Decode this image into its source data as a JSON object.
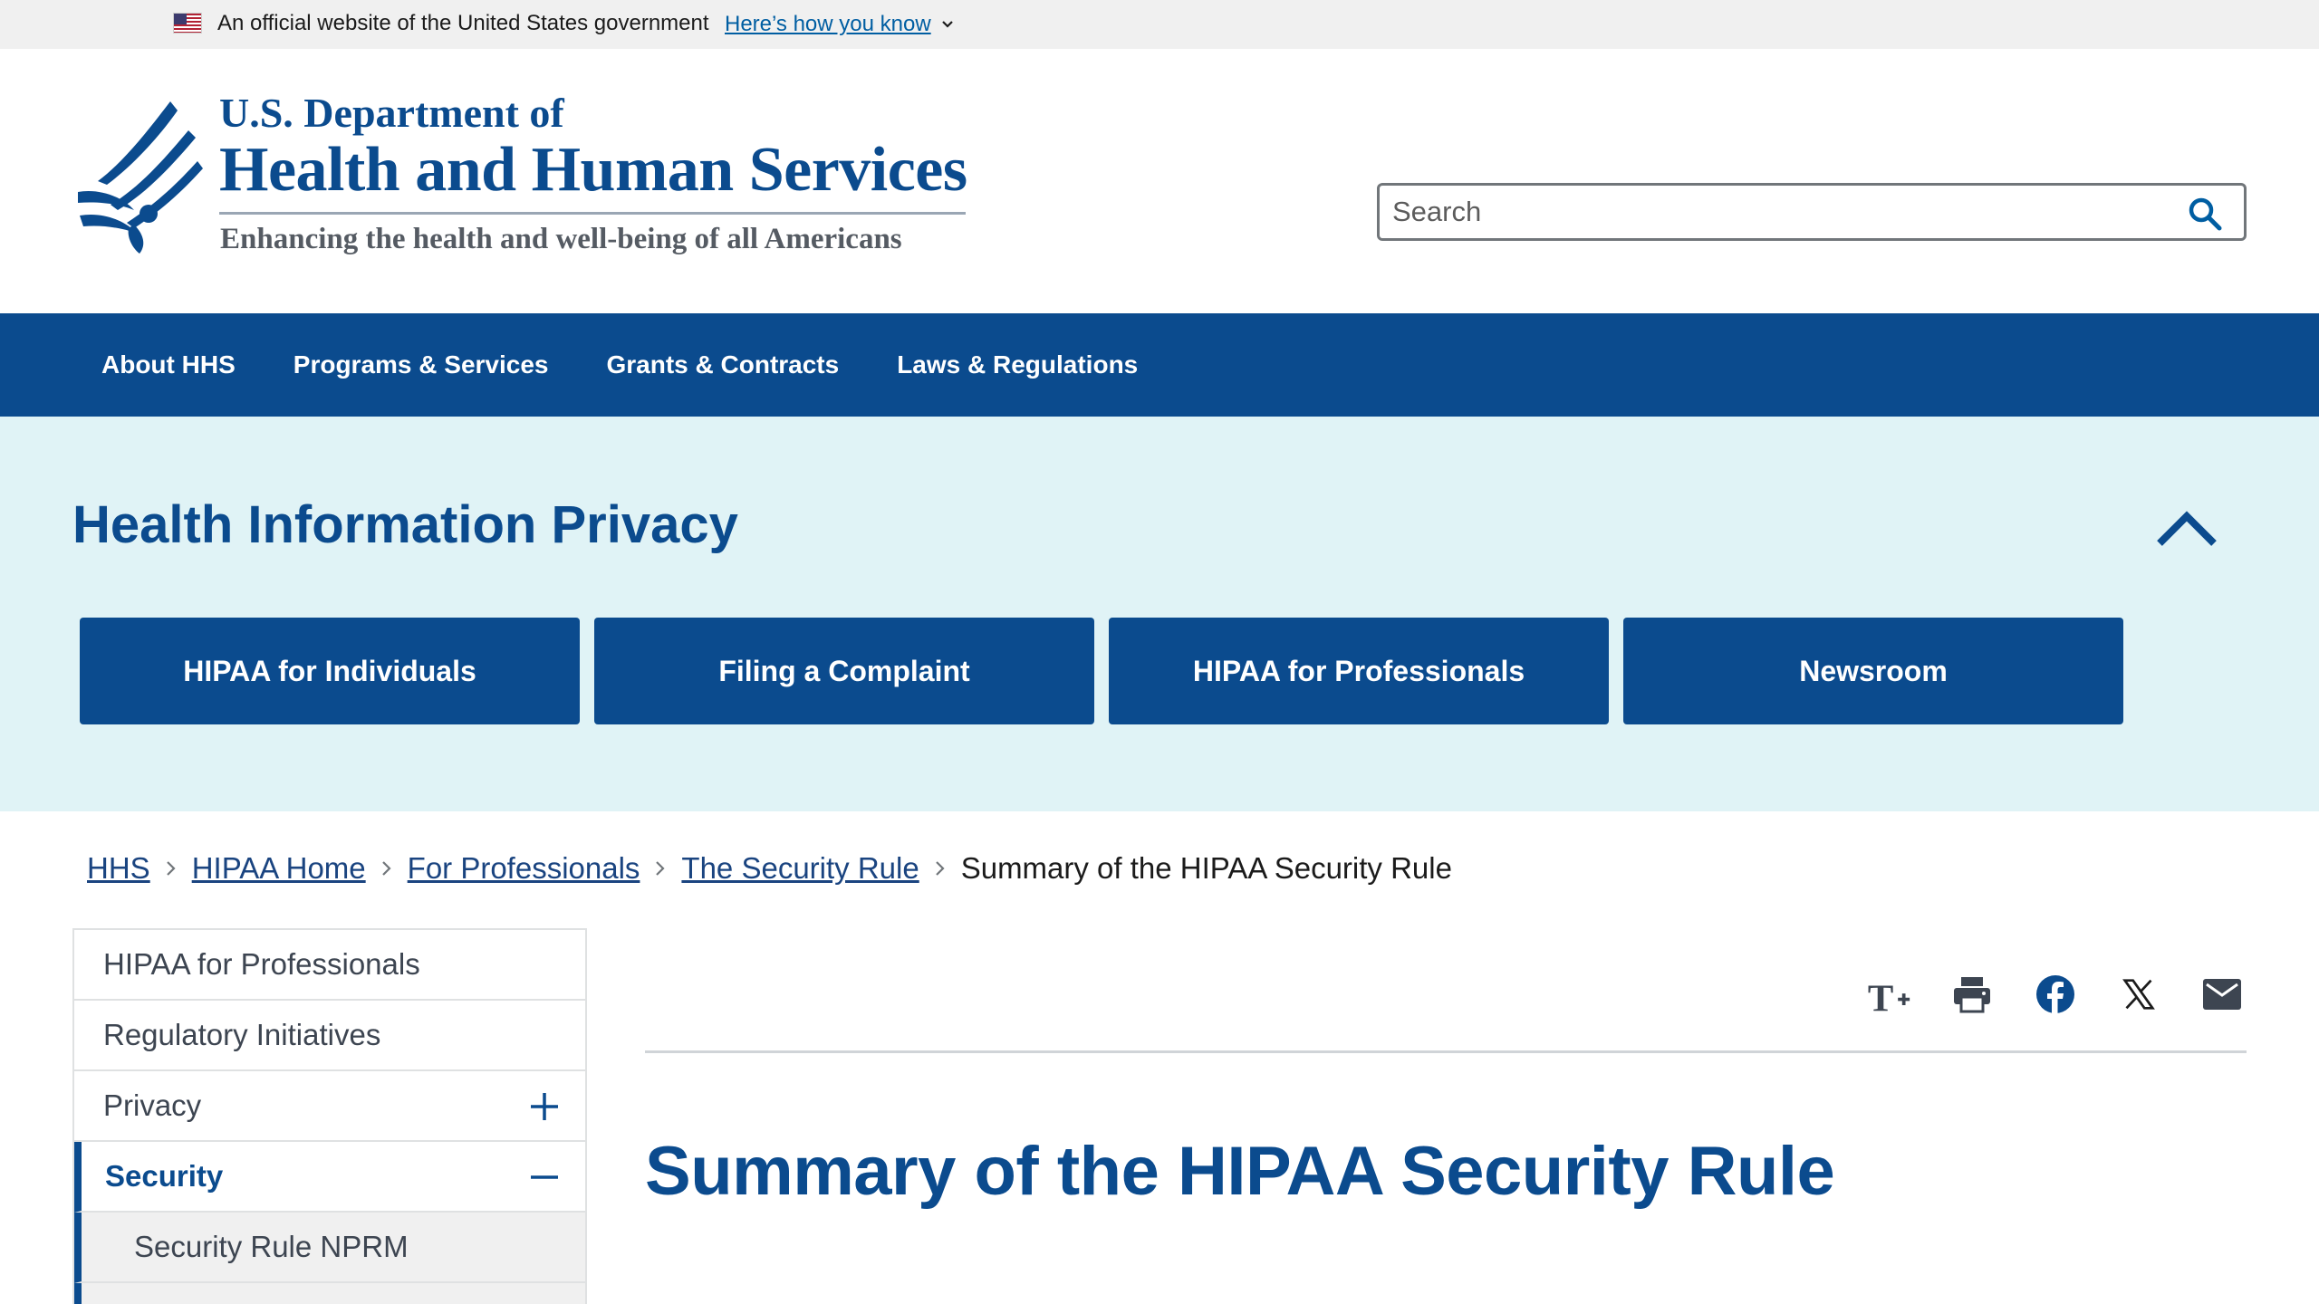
{
  "gov_banner": {
    "text": "An official website of the United States government",
    "link": "Here’s how you know"
  },
  "header": {
    "dept_line": "U.S. Department of",
    "agency_name": "Health and Human Services",
    "tagline": "Enhancing the health and well-being of all Americans",
    "search_placeholder": "Search"
  },
  "nav": {
    "items": [
      {
        "label": "About HHS"
      },
      {
        "label": "Programs & Services"
      },
      {
        "label": "Grants & Contracts"
      },
      {
        "label": "Laws & Regulations"
      }
    ]
  },
  "hero": {
    "title": "Health Information Privacy",
    "buttons": [
      {
        "label": "HIPAA for Individuals"
      },
      {
        "label": "Filing a Complaint"
      },
      {
        "label": "HIPAA for Professionals"
      },
      {
        "label": "Newsroom"
      }
    ]
  },
  "breadcrumb": {
    "items": [
      {
        "label": "HHS"
      },
      {
        "label": "HIPAA Home"
      },
      {
        "label": "For Professionals"
      },
      {
        "label": "The Security Rule"
      }
    ],
    "current": "Summary of the HIPAA Security Rule"
  },
  "sidenav": {
    "items": [
      {
        "label": "HIPAA for Professionals"
      },
      {
        "label": "Regulatory Initiatives"
      },
      {
        "label": "Privacy"
      },
      {
        "label": "Security"
      },
      {
        "label": "Security Rule NPRM"
      }
    ]
  },
  "tools": {
    "icons": [
      "text-size-icon",
      "print-icon",
      "facebook-icon",
      "x-icon",
      "email-icon"
    ]
  },
  "page": {
    "title": "Summary of the HIPAA Security Rule"
  },
  "colors": {
    "primary": "#0b4b8e",
    "hero_bg": "#e0f3f6",
    "banner_bg": "#f0f0f0",
    "link": "#1a4480"
  }
}
